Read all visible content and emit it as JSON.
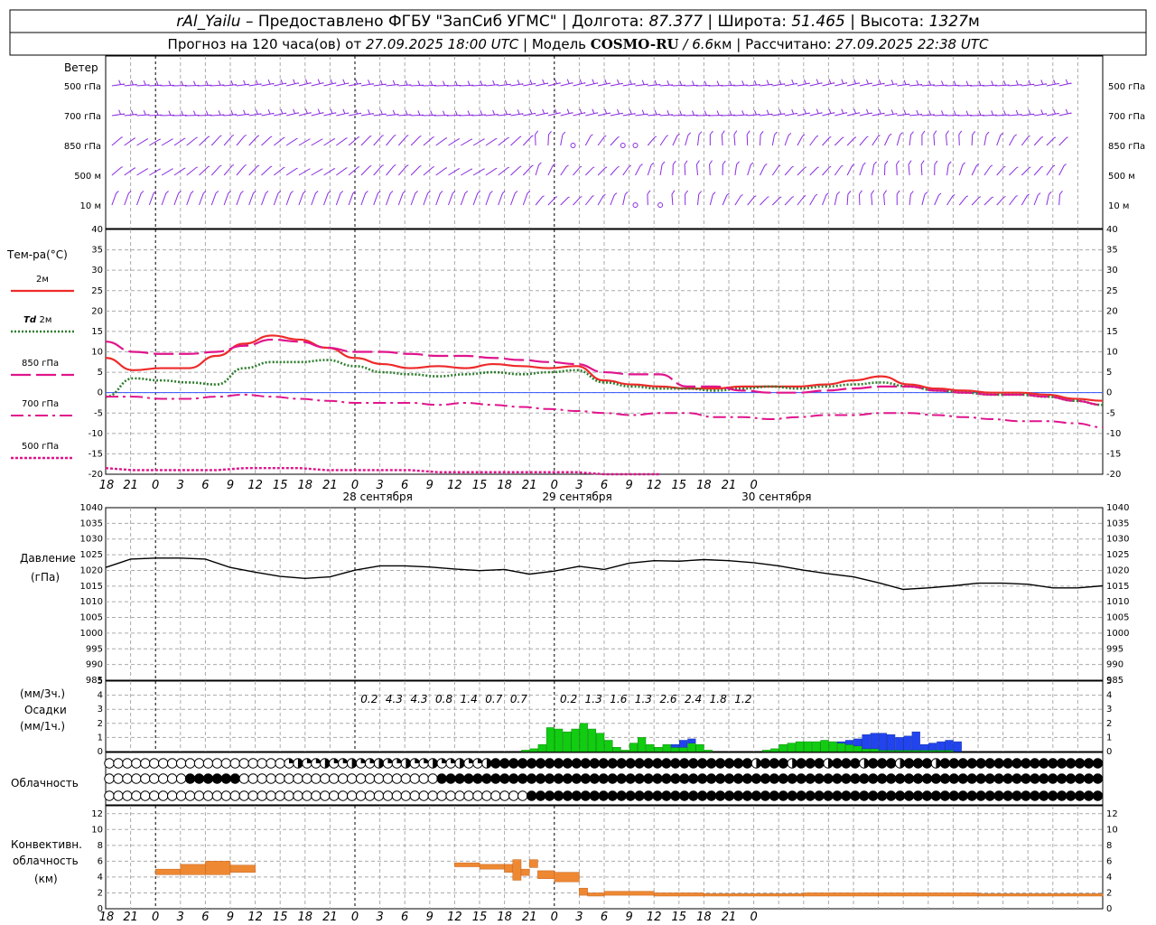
{
  "header": {
    "line1": {
      "station": "rAl_Yailu",
      "provider": "– Предоставлено ФГБУ \"ЗапСиб УГМС\"",
      "lon_label": "Долгота:",
      "lon": "87.377",
      "lat_label": "Широта:",
      "lat": "51.465",
      "alt_label": "Высота:",
      "alt": "1327",
      "alt_unit": "м"
    },
    "line2": {
      "forecast_prefix": "Прогноз на 120 часа(ов) от",
      "forecast_from": "27.09.2025 18:00 UTC",
      "model_label": "Модель",
      "model": "COSMO-RU",
      "resolution": "/ 6.6",
      "resolution_unit": "км",
      "calc_label": "Рассчитано:",
      "calc": "27.09.2025 22:38 UTC"
    }
  },
  "time_axis": {
    "hour_labels": [
      "18",
      "21",
      "0",
      "3",
      "6",
      "9",
      "12",
      "15",
      "18",
      "21",
      "0",
      "3",
      "6",
      "9",
      "12",
      "15",
      "18",
      "21",
      "0",
      "3",
      "6",
      "9",
      "12",
      "15",
      "18",
      "21",
      "0"
    ],
    "dates": [
      "28 сентября",
      "29 сентября",
      "30 сентября"
    ],
    "midnight_indices": [
      2,
      10,
      18
    ]
  },
  "wind_panel": {
    "title": "Ветер",
    "levels": [
      "500 гПа",
      "700 гПа",
      "850 гПа",
      "500 м",
      "10 м"
    ],
    "colors": {
      "barb": "#8a2be2"
    }
  },
  "temperature_panel": {
    "title": "Тем-ра(°C)",
    "ylim": [
      -20,
      40
    ],
    "yticks": [
      -20,
      -15,
      -10,
      -5,
      0,
      5,
      10,
      15,
      20,
      25,
      30,
      35,
      40
    ],
    "legend": [
      {
        "name": "2м",
        "color": "#ee2a2a",
        "style": "solid"
      },
      {
        "name": "Td",
        "sub": "2м",
        "color": "#2e7d2e",
        "style": "dotted"
      },
      {
        "name": "850 гПа",
        "color": "#e0148c",
        "style": "longdash"
      },
      {
        "name": "700 гПа",
        "color": "#e0148c",
        "style": "dashdot"
      },
      {
        "name": "500 гПа",
        "color": "#e0148c",
        "style": "dense"
      }
    ]
  },
  "pressure_panel": {
    "title": "Давление",
    "unit": "(гПа)",
    "ylim": [
      985,
      1040
    ],
    "yticks": [
      985,
      990,
      995,
      1000,
      1005,
      1010,
      1015,
      1020,
      1025,
      1030,
      1035,
      1040
    ]
  },
  "precip_panel": {
    "unit_3h": "(мм/3ч.)",
    "title": "Осадки",
    "unit_1h": "(мм/1ч.)",
    "ylim": [
      0,
      5
    ],
    "yticks": [
      0,
      1,
      2,
      3,
      4,
      5
    ],
    "totals_3h": [
      {
        "hour_index": 10,
        "label": "0.2"
      },
      {
        "hour_index": 11,
        "label": "4.3"
      },
      {
        "hour_index": 12,
        "label": "4.3"
      },
      {
        "hour_index": 13,
        "label": "0.8"
      },
      {
        "hour_index": 14,
        "label": "1.4"
      },
      {
        "hour_index": 15,
        "label": "0.7"
      },
      {
        "hour_index": 16,
        "label": "0.7"
      },
      {
        "hour_index": 18,
        "label": "0.2"
      },
      {
        "hour_index": 19,
        "label": "1.3"
      },
      {
        "hour_index": 20,
        "label": "1.6"
      },
      {
        "hour_index": 21,
        "label": "1.3"
      },
      {
        "hour_index": 22,
        "label": "2.6"
      },
      {
        "hour_index": 23,
        "label": "2.4"
      },
      {
        "hour_index": 24,
        "label": "1.8"
      },
      {
        "hour_index": 25,
        "label": "1.2"
      }
    ],
    "colors": {
      "rain": "#11cc11",
      "snow": "#2244ee"
    }
  },
  "cloud_panel": {
    "title": "Облачность"
  },
  "convective_panel": {
    "title_line1": "Конвективн.",
    "title_line2": "облачность",
    "unit": "(км)",
    "ylim": [
      0,
      13
    ],
    "yticks": [
      0,
      2,
      4,
      6,
      8,
      10,
      12
    ],
    "color": "#ee8833"
  },
  "chart_data": [
    {
      "type": "line",
      "title": "Тем-ра(°C)",
      "x_hours": [
        0,
        3,
        6,
        9,
        12,
        15,
        18,
        21,
        24,
        27,
        30,
        33,
        36,
        39,
        42,
        45,
        48,
        51,
        54,
        57,
        60,
        63,
        66,
        69,
        72,
        75,
        78,
        81,
        84,
        87,
        90,
        93,
        96,
        99,
        102,
        105,
        108,
        111,
        114,
        117,
        120
      ],
      "ylim": [
        -20,
        40
      ],
      "series": [
        {
          "name": "2м",
          "values": [
            8.5,
            5.5,
            6,
            6,
            9,
            12,
            14,
            13,
            11,
            8.5,
            7,
            6,
            6.5,
            6,
            7,
            6.5,
            6,
            6.5,
            3,
            2,
            1.5,
            1,
            1,
            1.5,
            1.5,
            1.5,
            2,
            3,
            4,
            2,
            1,
            0.5,
            0,
            0,
            -0.5,
            -1.5,
            -2
          ]
        },
        {
          "name": "Td 2м",
          "values": [
            -1,
            3.5,
            3,
            2.5,
            2,
            6,
            7.5,
            7.5,
            8,
            6.5,
            5,
            4.5,
            4,
            4.5,
            5,
            4.5,
            5,
            5.5,
            2.5,
            1.5,
            1,
            1,
            0.5,
            1,
            1.5,
            1,
            1.5,
            2,
            2.5,
            1.5,
            0.5,
            0,
            -0.5,
            -0.5,
            -1,
            -2,
            -3
          ]
        },
        {
          "name": "850 гПа",
          "values": [
            12.5,
            10,
            9.5,
            9.5,
            10,
            11.5,
            13,
            12.5,
            11,
            10,
            10,
            9.5,
            9,
            9,
            8.5,
            8,
            7.5,
            7,
            5,
            4.5,
            4.5,
            1.5,
            1.5,
            0.5,
            0,
            0,
            0.5,
            1,
            1.5,
            1.5,
            0.5,
            0,
            -0.5,
            -0.5,
            -1,
            -2,
            -3
          ]
        },
        {
          "name": "700 гПа",
          "values": [
            -1,
            -1,
            -1.5,
            -1.5,
            -1,
            -0.5,
            -1,
            -1.5,
            -2,
            -2.5,
            -2.5,
            -2.5,
            -3,
            -2.5,
            -3,
            -3.5,
            -4,
            -4.5,
            -5,
            -5.5,
            -5,
            -5,
            -6,
            -6,
            -6.5,
            -6,
            -5.5,
            -5.5,
            -5,
            -5,
            -5.5,
            -6,
            -6.5,
            -7,
            -7,
            -7.5,
            -8.5
          ]
        },
        {
          "name": "500 гПа",
          "values": [
            -18.5,
            -19,
            -19,
            -19,
            -19,
            -18.5,
            -18.5,
            -18.5,
            -19,
            -19,
            -19,
            -19,
            -19.5,
            -19.5,
            -19.5,
            -19.5,
            -19.5,
            -19.5,
            -20,
            -20,
            -20,
            -20,
            -20,
            -20,
            -19,
            -20,
            -20,
            -20,
            -20,
            -20,
            -20,
            -20,
            -20,
            -20,
            -20,
            -20,
            -20
          ]
        }
      ]
    },
    {
      "type": "line",
      "title": "Давление",
      "ylim": [
        985,
        1040
      ],
      "x_hours": [
        0,
        3,
        6,
        9,
        12,
        15,
        18,
        21,
        24,
        27,
        30,
        33,
        36,
        39,
        42,
        45,
        48,
        51,
        54,
        57,
        60,
        63,
        66,
        69,
        72,
        75,
        78,
        81,
        84,
        87,
        90,
        93,
        96,
        99,
        102,
        105,
        108,
        111,
        114,
        117,
        120
      ],
      "series": [
        {
          "name": "Давление",
          "values": [
            1021,
            1023.5,
            1024,
            1024,
            1023.5,
            1021,
            1019.5,
            1018,
            1017.5,
            1018,
            1020,
            1021.5,
            1021.5,
            1021,
            1020.5,
            1020,
            1020,
            1019,
            1020,
            1021,
            1020.5,
            1022.5,
            1023,
            1023,
            1023.5,
            1023,
            1022.5,
            1021.5,
            1020,
            1019,
            1018,
            1016,
            1014,
            1014.5,
            1015,
            1016,
            1016,
            1015.5,
            1014.5,
            1014.5,
            1015
          ]
        }
      ]
    },
    {
      "type": "bar",
      "title": "Осадки",
      "unit": "мм/1ч.",
      "ylim": [
        0,
        5
      ],
      "x_hours": [
        51,
        52,
        53,
        54,
        55,
        56,
        57,
        58,
        59,
        60,
        61,
        62,
        63,
        64,
        65,
        66,
        67,
        68,
        69,
        70,
        71,
        72,
        73,
        74,
        75,
        76,
        77,
        78,
        79,
        80,
        81,
        82,
        83,
        84,
        85,
        86,
        87,
        88,
        89,
        90,
        91,
        92,
        93,
        94,
        95,
        96,
        97,
        98,
        99,
        100,
        101,
        102,
        103,
        104,
        105,
        106,
        107,
        108,
        109,
        110,
        111,
        112,
        113,
        114,
        115,
        116,
        117,
        118,
        119,
        120
      ],
      "series": [
        {
          "name": "rain",
          "values": [
            0.1,
            0.2,
            0.5,
            1.7,
            1.6,
            1.4,
            1.6,
            2.0,
            1.6,
            1.3,
            0.8,
            0.3,
            0.1,
            0.6,
            1.0,
            0.5,
            0.3,
            0.5,
            0.3,
            0.3,
            0.6,
            0.5,
            0.1,
            0,
            0,
            0,
            0,
            0,
            0,
            0.1,
            0.2,
            0.5,
            0.6,
            0.7,
            0.7,
            0.7,
            0.8,
            0.7,
            0.6,
            0.5,
            0.4,
            0.2,
            0.2,
            0.1,
            0.1,
            0.1,
            0.1,
            0.1,
            0.1,
            0.1,
            0.1,
            0.1,
            0,
            0,
            0,
            0,
            0,
            0,
            0,
            0,
            0,
            0,
            0,
            0,
            0,
            0,
            0,
            0,
            0,
            0
          ]
        },
        {
          "name": "snow",
          "values": [
            0,
            0,
            0,
            0,
            0,
            0,
            0,
            0,
            0,
            0,
            0,
            0,
            0,
            0,
            0,
            0,
            0,
            0,
            0.2,
            0.5,
            0.3,
            0,
            0,
            0,
            0,
            0,
            0,
            0,
            0,
            0,
            0,
            0,
            0,
            0,
            0,
            0,
            0,
            0,
            0.1,
            0.3,
            0.5,
            1.0,
            1.1,
            1.2,
            1.1,
            0.9,
            1.0,
            1.3,
            0.4,
            0.5,
            0.6,
            0.7,
            0.7,
            0,
            0,
            0,
            0,
            0,
            0,
            0,
            0,
            0,
            0,
            0,
            0,
            0,
            0,
            0,
            0,
            0
          ]
        }
      ]
    },
    {
      "type": "bar",
      "title": "Конвективн. облачность",
      "unit": "км",
      "ylim": [
        0,
        13
      ],
      "segments": [
        {
          "h0": 6,
          "h1": 9,
          "top": 5.0,
          "bot": 4.3
        },
        {
          "h0": 9,
          "h1": 12,
          "top": 5.6,
          "bot": 4.3
        },
        {
          "h0": 12,
          "h1": 15,
          "top": 6.0,
          "bot": 4.3
        },
        {
          "h0": 15,
          "h1": 18,
          "top": 5.5,
          "bot": 4.6
        },
        {
          "h0": 42,
          "h1": 45,
          "top": 5.8,
          "bot": 5.3
        },
        {
          "h0": 45,
          "h1": 48,
          "top": 5.6,
          "bot": 5.0
        },
        {
          "h0": 48,
          "h1": 49,
          "top": 5.6,
          "bot": 4.6
        },
        {
          "h0": 49,
          "h1": 50,
          "top": 6.2,
          "bot": 3.6
        },
        {
          "h0": 50,
          "h1": 51,
          "top": 5.0,
          "bot": 4.2
        },
        {
          "h0": 51,
          "h1": 52,
          "top": 6.2,
          "bot": 5.2
        },
        {
          "h0": 52,
          "h1": 54,
          "top": 4.8,
          "bot": 3.8
        },
        {
          "h0": 54,
          "h1": 57,
          "top": 4.6,
          "bot": 3.4
        },
        {
          "h0": 57,
          "h1": 58,
          "top": 2.6,
          "bot": 1.7
        },
        {
          "h0": 58,
          "h1": 60,
          "top": 2.0,
          "bot": 1.6
        },
        {
          "h0": 60,
          "h1": 66,
          "top": 2.2,
          "bot": 1.7
        },
        {
          "h0": 66,
          "h1": 72,
          "top": 2.0,
          "bot": 1.6
        },
        {
          "h0": 72,
          "h1": 84,
          "top": 1.9,
          "bot": 1.6
        },
        {
          "h0": 84,
          "h1": 93,
          "top": 2.0,
          "bot": 1.6
        },
        {
          "h0": 93,
          "h1": 105,
          "top": 2.0,
          "bot": 1.6
        },
        {
          "h0": 105,
          "h1": 120,
          "top": 1.9,
          "bot": 1.6
        }
      ]
    }
  ]
}
